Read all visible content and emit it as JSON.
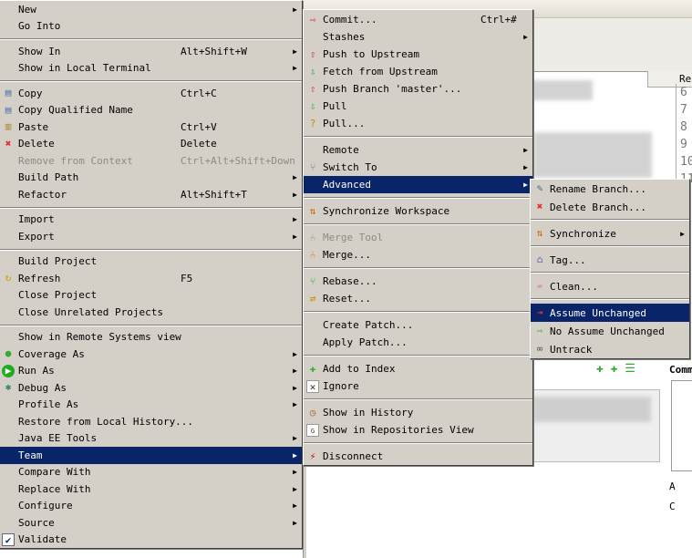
{
  "colors": {
    "menu_bg": "#d4d0c8",
    "highlight": "#0a246a",
    "disabled": "#8e8b84"
  },
  "background": {
    "table_header": "Re",
    "line_numbers": [
      "6",
      "7",
      "8",
      "9",
      "10",
      "11"
    ],
    "commit_label": "Comm",
    "icon_rows": [
      "A",
      "C"
    ]
  },
  "context_menu": [
    {
      "label": "New",
      "submenu": true
    },
    {
      "label": "Go Into"
    },
    {
      "sep": true
    },
    {
      "label": "Show In",
      "shortcut": "Alt+Shift+W",
      "submenu": true
    },
    {
      "label": "Show in Local Terminal",
      "submenu": true
    },
    {
      "sep": true
    },
    {
      "label": "Copy",
      "shortcut": "Ctrl+C",
      "icon": "copy-icon"
    },
    {
      "label": "Copy Qualified Name",
      "icon": "copy-qualified-name-icon"
    },
    {
      "label": "Paste",
      "shortcut": "Ctrl+V",
      "icon": "paste-icon"
    },
    {
      "label": "Delete",
      "shortcut": "Delete",
      "icon": "delete-icon"
    },
    {
      "label": "Remove from Context",
      "shortcut": "Ctrl+Alt+Shift+Down",
      "disabled": true
    },
    {
      "label": "Build Path",
      "submenu": true
    },
    {
      "label": "Refactor",
      "shortcut": "Alt+Shift+T",
      "submenu": true
    },
    {
      "sep": true
    },
    {
      "label": "Import",
      "submenu": true
    },
    {
      "label": "Export",
      "submenu": true
    },
    {
      "sep": true
    },
    {
      "label": "Build Project"
    },
    {
      "label": "Refresh",
      "shortcut": "F5",
      "icon": "refresh-icon"
    },
    {
      "label": "Close Project"
    },
    {
      "label": "Close Unrelated Projects"
    },
    {
      "sep": true
    },
    {
      "label": "Show in Remote Systems view"
    },
    {
      "label": "Coverage As",
      "submenu": true,
      "icon": "coverage-icon"
    },
    {
      "label": "Run As",
      "submenu": true,
      "icon": "run-icon"
    },
    {
      "label": "Debug As",
      "submenu": true,
      "icon": "debug-icon"
    },
    {
      "label": "Profile As",
      "submenu": true
    },
    {
      "label": "Restore from Local History..."
    },
    {
      "label": "Java EE Tools",
      "submenu": true
    },
    {
      "label": "Team",
      "submenu": true,
      "selected": true
    },
    {
      "label": "Compare With",
      "submenu": true
    },
    {
      "label": "Replace With",
      "submenu": true
    },
    {
      "label": "Configure",
      "submenu": true
    },
    {
      "label": "Source",
      "submenu": true
    },
    {
      "label": "Validate",
      "icon": "checkbox-checked-icon"
    }
  ],
  "team_menu": [
    {
      "label": "Commit...",
      "shortcut": "Ctrl+#",
      "icon": "commit-icon"
    },
    {
      "label": "Stashes",
      "submenu": true
    },
    {
      "label": "Push to Upstream",
      "icon": "push-icon"
    },
    {
      "label": "Fetch from Upstream",
      "icon": "fetch-icon"
    },
    {
      "label": "Push Branch 'master'...",
      "icon": "push-branch-icon"
    },
    {
      "label": "Pull",
      "icon": "pull-icon"
    },
    {
      "label": "Pull...",
      "icon": "pull-dialog-icon"
    },
    {
      "sep": true
    },
    {
      "label": "Remote",
      "submenu": true
    },
    {
      "label": "Switch To",
      "submenu": true,
      "icon": "switch-branch-icon"
    },
    {
      "label": "Advanced",
      "submenu": true,
      "selected": true
    },
    {
      "sep": true
    },
    {
      "label": "Synchronize Workspace",
      "icon": "synchronize-icon"
    },
    {
      "sep": true
    },
    {
      "label": "Merge Tool",
      "disabled": true,
      "icon": "merge-tool-icon"
    },
    {
      "label": "Merge...",
      "icon": "merge-icon"
    },
    {
      "sep": true
    },
    {
      "label": "Rebase...",
      "icon": "rebase-icon"
    },
    {
      "label": "Reset...",
      "icon": "reset-icon"
    },
    {
      "sep": true
    },
    {
      "label": "Create Patch..."
    },
    {
      "label": "Apply Patch..."
    },
    {
      "sep": true
    },
    {
      "label": "Add to Index",
      "icon": "add-icon"
    },
    {
      "label": "Ignore",
      "icon": "ignore-icon"
    },
    {
      "sep": true
    },
    {
      "label": "Show in History",
      "icon": "history-icon"
    },
    {
      "label": "Show in Repositories View",
      "icon": "repository-icon"
    },
    {
      "sep": true
    },
    {
      "label": "Disconnect",
      "icon": "disconnect-icon"
    }
  ],
  "advanced_menu": [
    {
      "label": "Rename Branch...",
      "icon": "rename-icon"
    },
    {
      "label": "Delete Branch...",
      "icon": "delete-icon"
    },
    {
      "sep": true
    },
    {
      "label": "Synchronize",
      "submenu": true,
      "icon": "synchronize-icon"
    },
    {
      "sep": true
    },
    {
      "label": "Tag...",
      "icon": "tag-icon"
    },
    {
      "sep": true
    },
    {
      "label": "Clean...",
      "icon": "clean-icon"
    },
    {
      "sep": true
    },
    {
      "label": "Assume Unchanged",
      "selected": true,
      "icon": "assume-unchanged-icon"
    },
    {
      "label": "No Assume Unchanged",
      "icon": "no-assume-unchanged-icon"
    },
    {
      "label": "Untrack",
      "icon": "untrack-icon"
    }
  ]
}
